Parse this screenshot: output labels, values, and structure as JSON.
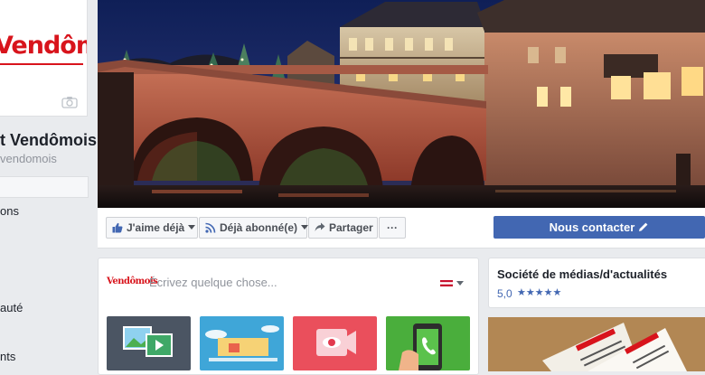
{
  "sidebar": {
    "logo_text": "Vendômois",
    "page_name": "t Vendômois",
    "page_handle": "vendomois",
    "nav_items": [
      {
        "label": "ons"
      },
      {
        "label": "auté"
      },
      {
        "label": "nts"
      }
    ]
  },
  "actions": {
    "like_label": "J'aime déjà",
    "follow_label": "Déjà abonné(e)",
    "share_label": "Partager",
    "more_label": "···",
    "contact_label": "Nous contacter"
  },
  "composer": {
    "logo_text": "Vendômois",
    "placeholder": "Écrivez quelque chose..."
  },
  "about": {
    "category": "Société de médias/d'actualités",
    "rating_value": "5,0",
    "rating_stars": "★★★★★",
    "stars": 5
  },
  "colors": {
    "brand_red": "#d8141c",
    "facebook_blue": "#4267b2",
    "tile_photo": "#4b5563",
    "tile_event": "#3fa6d8",
    "tile_video": "#ea4f5c",
    "tile_call": "#4aae3c"
  }
}
